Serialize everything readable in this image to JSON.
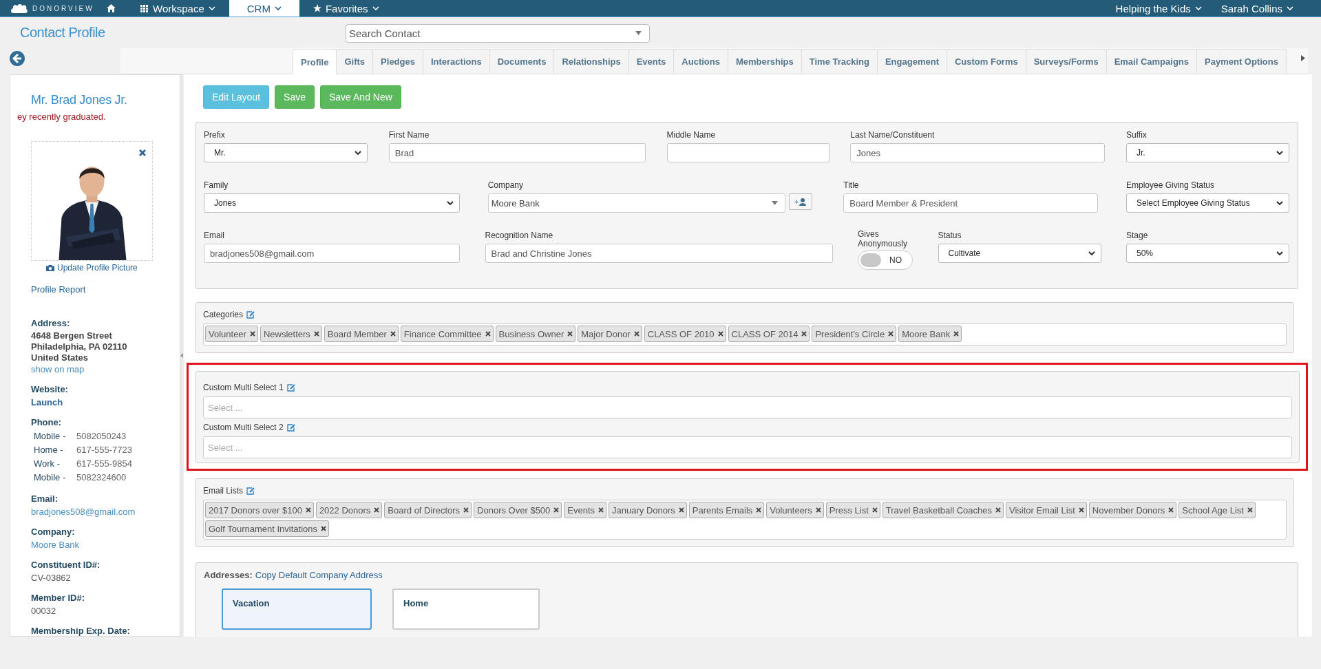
{
  "topbar": {
    "logo": "DONORVIEW",
    "nav": [
      {
        "label": "Workspace",
        "selected": false
      },
      {
        "label": "CRM",
        "selected": true
      },
      {
        "label": "Favorites",
        "selected": false
      }
    ],
    "organization": "Helping the Kids",
    "user": "Sarah Collins"
  },
  "header": {
    "title": "Contact Profile",
    "search_placeholder": "Search Contact"
  },
  "tabs": [
    {
      "label": "Profile",
      "selected": true
    },
    {
      "label": "Gifts",
      "selected": false
    },
    {
      "label": "Pledges",
      "selected": false
    },
    {
      "label": "Interactions",
      "selected": false
    },
    {
      "label": "Documents",
      "selected": false
    },
    {
      "label": "Relationships",
      "selected": false
    },
    {
      "label": "Events",
      "selected": false
    },
    {
      "label": "Auctions",
      "selected": false
    },
    {
      "label": "Memberships",
      "selected": false
    },
    {
      "label": "Time Tracking",
      "selected": false
    },
    {
      "label": "Engagement",
      "selected": false
    },
    {
      "label": "Custom Forms",
      "selected": false
    },
    {
      "label": "Surveys/Forms",
      "selected": false
    },
    {
      "label": "Email Campaigns",
      "selected": false
    },
    {
      "label": "Payment Options",
      "selected": false
    }
  ],
  "profile": {
    "name": "Mr. Brad Jones Jr.",
    "note": "ey recently graduated.",
    "update_picture": "Update Profile Picture",
    "report": "Profile Report",
    "sections": [
      {
        "label": "Address:",
        "lines": [
          {
            "kind": "strong",
            "text": "4648 Bergen Street"
          },
          {
            "kind": "strong",
            "text": "Philadelphia, PA 02110"
          },
          {
            "kind": "strong",
            "text": "United States"
          },
          {
            "kind": "link",
            "text": "show on map"
          }
        ]
      },
      {
        "label": "Website:",
        "lines": [
          {
            "kind": "link-strong",
            "text": "Launch"
          }
        ]
      },
      {
        "label": "Phone:",
        "lines": [
          {
            "kind": "phone",
            "type": "Mobile -",
            "number": "5082050243"
          },
          {
            "kind": "phone",
            "type": "Home -",
            "number": "617-555-7723"
          },
          {
            "kind": "phone",
            "type": "Work -",
            "number": "617-555-9854"
          },
          {
            "kind": "phone",
            "type": "Mobile -",
            "number": "5082324600"
          }
        ]
      },
      {
        "label": "Email:",
        "lines": [
          {
            "kind": "link",
            "text": "bradjones508@gmail.com"
          }
        ]
      },
      {
        "label": "Company:",
        "lines": [
          {
            "kind": "link",
            "text": "Moore Bank"
          }
        ]
      },
      {
        "label": "Constituent ID#:",
        "lines": [
          {
            "kind": "plain",
            "text": "CV-03862"
          }
        ]
      },
      {
        "label": "Member ID#:",
        "lines": [
          {
            "kind": "plain",
            "text": "00032"
          }
        ]
      },
      {
        "label": "Membership Exp. Date:"
      }
    ]
  },
  "actions": [
    {
      "label": "Edit Layout",
      "kind": "info"
    },
    {
      "label": "Save",
      "kind": "success"
    },
    {
      "label": "Save And New",
      "kind": "success"
    }
  ],
  "form": {
    "rows": [
      {
        "fields": [
          {
            "label": "Prefix",
            "kind": "select",
            "value": "Mr."
          },
          {
            "label": "First Name",
            "kind": "text",
            "value": "Brad"
          },
          {
            "label": "Middle Name",
            "kind": "text"
          },
          {
            "label": "Last Name/Constituent",
            "kind": "text",
            "value": "Jones"
          },
          {
            "label": "Suffix",
            "kind": "select",
            "value": "Jr."
          }
        ]
      },
      {
        "fields": [
          {
            "label": "Family",
            "kind": "select",
            "value": "Jones"
          },
          {
            "label": "Company",
            "kind": "combo",
            "value": "Moore Bank",
            "add_button": "+"
          },
          {
            "label": "Title",
            "kind": "text",
            "value": "Board Member & President"
          },
          {
            "label": "Employee Giving Status",
            "kind": "select",
            "value": "Select Employee Giving Status"
          }
        ]
      },
      {
        "fields": [
          {
            "label": "Email",
            "kind": "text",
            "value": "bradjones508@gmail.com"
          },
          {
            "label": "Recognition Name",
            "kind": "text",
            "value": "Brad and Christine Jones"
          },
          {
            "label": "Gives Anonymously",
            "kind": "toggle",
            "on": false,
            "text": "NO"
          },
          {
            "label": "Status",
            "kind": "select",
            "value": "Cultivate"
          },
          {
            "label": "Stage",
            "kind": "select",
            "value": "50%"
          }
        ]
      }
    ]
  },
  "sections": [
    {
      "kind": "tags",
      "highlighted": false,
      "groups": [
        {
          "label": "Categories",
          "tags": [
            "Volunteer",
            "Newsletters",
            "Board Member",
            "Finance Committee",
            "Business Owner",
            "Major Donor",
            "CLASS OF 2010",
            "CLASS OF 2014",
            "President's Circle",
            "Moore Bank"
          ]
        }
      ]
    },
    {
      "kind": "tags",
      "highlighted": true,
      "groups": [
        {
          "label": "Custom Multi Select 1",
          "placeholder": "Select ..."
        },
        {
          "label": "Custom Multi Select 2",
          "placeholder": "Select ..."
        }
      ]
    },
    {
      "kind": "tags",
      "highlighted": false,
      "groups": [
        {
          "label": "Email Lists",
          "tags": [
            "2017 Donors over $100",
            "2022 Donors",
            "Board of Directors",
            "Donors Over $500",
            "Events",
            "January Donors",
            "Parents Emails",
            "Volunteers",
            "Press List",
            "Travel Basketball Coaches",
            "Visitor Email List",
            "November Donors",
            "School Age List",
            "Golf Tournament Invitations"
          ]
        }
      ]
    },
    {
      "kind": "addresses",
      "label": "Addresses:",
      "link": "Copy Default Company Address",
      "cards": [
        {
          "title": "Vacation",
          "selected": true
        },
        {
          "title": "Home",
          "selected": false
        }
      ]
    }
  ]
}
